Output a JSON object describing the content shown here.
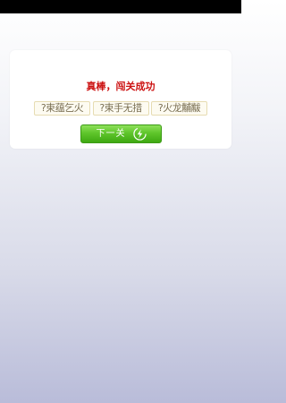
{
  "result": {
    "title": "真棒，闯关成功"
  },
  "answers": [
    "?束蕴乞火",
    "?束手无措",
    "?火龙黼黻"
  ],
  "next_button": {
    "label": "下一关",
    "icon": "lightning-icon"
  },
  "colors": {
    "title": "#cc1111",
    "button": "#5fc52b",
    "status_bar": "#000000"
  }
}
